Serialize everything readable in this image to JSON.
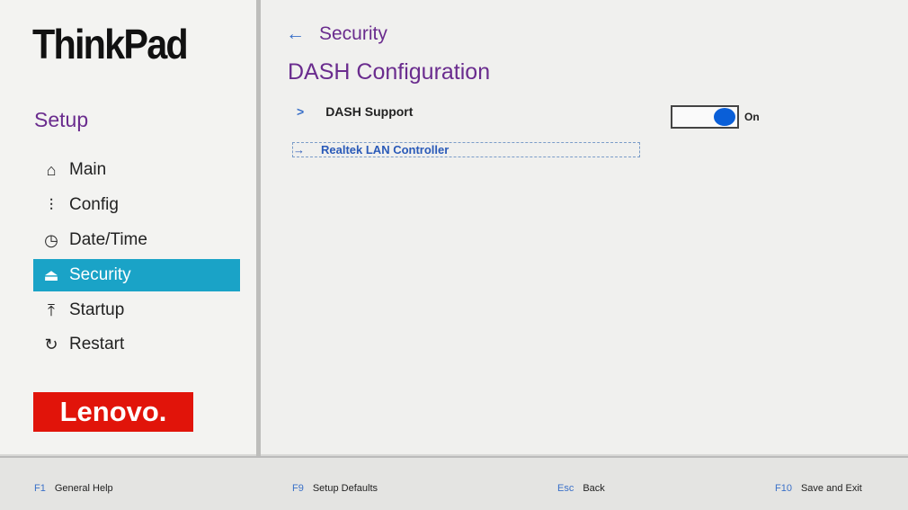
{
  "sidebar": {
    "brand": "ThinkPad",
    "heading": "Setup",
    "items": [
      {
        "label": "Main",
        "icon": "home-icon"
      },
      {
        "label": "Config",
        "icon": "sliders-icon"
      },
      {
        "label": "Date/Time",
        "icon": "clock-icon"
      },
      {
        "label": "Security",
        "icon": "lock-icon",
        "active": true
      },
      {
        "label": "Startup",
        "icon": "upload-icon"
      },
      {
        "label": "Restart",
        "icon": "restart-icon"
      }
    ],
    "vendor": "Lenovo."
  },
  "main": {
    "breadcrumb": "Security",
    "title": "DASH Configuration",
    "settings": [
      {
        "label": "DASH Support",
        "value": "On"
      },
      {
        "label": "Realtek LAN Controller"
      }
    ]
  },
  "footer": [
    {
      "key": "F1",
      "label": "General Help"
    },
    {
      "key": "F9",
      "label": "Setup Defaults"
    },
    {
      "key": "Esc",
      "label": "Back"
    },
    {
      "key": "F10",
      "label": "Save and Exit"
    }
  ],
  "colors": {
    "accent": "#1aa3c7",
    "title": "#6a2c8e",
    "toggle": "#0a5fd8"
  }
}
